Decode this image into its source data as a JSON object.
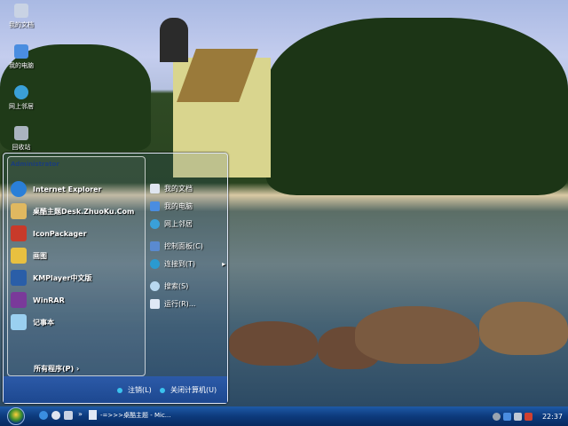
{
  "desktop": {
    "icons": [
      {
        "label": "我的文档",
        "icon": "documents-icon"
      },
      {
        "label": "我的电脑",
        "icon": "computer-icon"
      },
      {
        "label": "网上邻居",
        "icon": "network-icon"
      },
      {
        "label": "回收站",
        "icon": "recycle-bin-icon"
      }
    ]
  },
  "start_menu": {
    "user": "Administrator",
    "left_items": [
      {
        "label": "Internet Explorer",
        "icon": "ie-icon"
      },
      {
        "label": "桌酷主题Desk.ZhuoKu.Com",
        "icon": "theme-icon"
      },
      {
        "label": "IconPackager",
        "icon": "iconpackager-icon"
      },
      {
        "label": "画图",
        "icon": "paint-icon"
      },
      {
        "label": "KMPlayer中文版",
        "icon": "kmplayer-icon"
      },
      {
        "label": "WinRAR",
        "icon": "winrar-icon"
      },
      {
        "label": "记事本",
        "icon": "notepad-icon"
      }
    ],
    "all_programs": "所有程序(P)",
    "right_items": [
      {
        "label": "我的文档",
        "icon": "documents-icon"
      },
      {
        "label": "我的电脑",
        "icon": "computer-icon"
      },
      {
        "label": "网上邻居",
        "icon": "network-icon"
      },
      {
        "label": "控制面板(C)",
        "icon": "control-panel-icon"
      },
      {
        "label": "连接到(T)",
        "icon": "connect-icon"
      },
      {
        "label": "搜索(S)",
        "icon": "search-icon"
      },
      {
        "label": "运行(R)...",
        "icon": "run-icon"
      }
    ],
    "logoff": "注销(L)",
    "shutdown": "关闭计算机(U)"
  },
  "taskbar": {
    "task": "-=>>>桌酷主题 - Mic...",
    "clock": "22:37",
    "more": "»"
  }
}
